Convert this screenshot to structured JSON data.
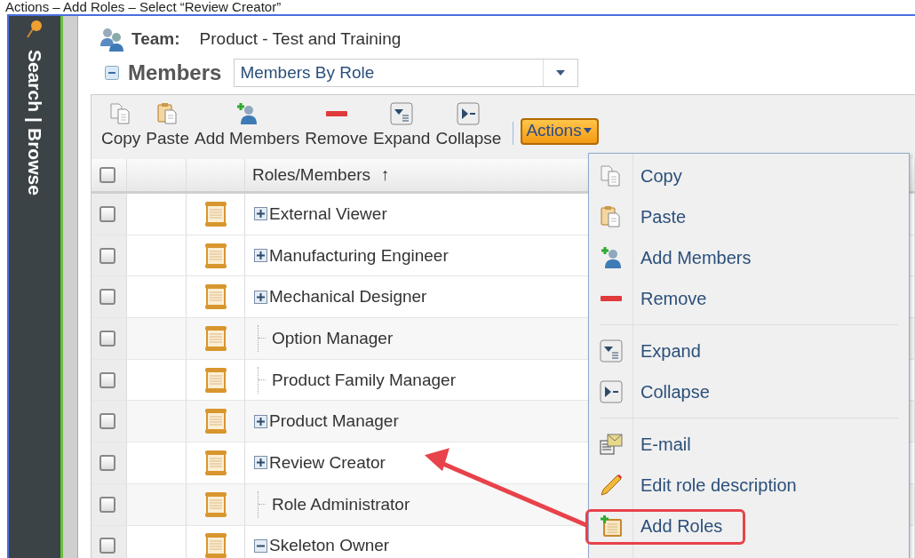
{
  "caption": "Actions – Add Roles – Select “Review Creator”",
  "sidebar": {
    "links": [
      "Search",
      "Browse"
    ],
    "separator": "|"
  },
  "team": {
    "label": "Team:",
    "value": "Product - Test and Training"
  },
  "members": {
    "title": "Members",
    "expanded": true,
    "view": "Members By Role"
  },
  "toolbar": [
    "Copy",
    "Paste",
    "Add Members",
    "Remove",
    "Expand",
    "Collapse"
  ],
  "actions_button": "Actions",
  "table": {
    "header_checked": false,
    "column": "Roles/Members",
    "sort": "↑",
    "rows": [
      {
        "name": "External Viewer",
        "kind": "group",
        "expanded": false,
        "checked": false
      },
      {
        "name": "Manufacturing Engineer",
        "kind": "group",
        "expanded": false,
        "checked": false
      },
      {
        "name": "Mechanical Designer",
        "kind": "group",
        "expanded": false,
        "checked": false
      },
      {
        "name": "Option Manager",
        "kind": "leaf",
        "checked": false
      },
      {
        "name": "Product Family Manager",
        "kind": "leaf",
        "checked": false
      },
      {
        "name": "Product Manager",
        "kind": "group",
        "expanded": false,
        "checked": false
      },
      {
        "name": "Review Creator",
        "kind": "group",
        "expanded": false,
        "checked": false
      },
      {
        "name": "Role Administrator",
        "kind": "leaf",
        "checked": false
      },
      {
        "name": "Skeleton Owner",
        "kind": "group",
        "expanded": true,
        "checked": false
      }
    ]
  },
  "menu": {
    "sections": [
      [
        {
          "label": "Copy",
          "highlighted": false
        },
        {
          "label": "Paste",
          "highlighted": false
        },
        {
          "label": "Add Members",
          "highlighted": false
        },
        {
          "label": "Remove",
          "highlighted": false
        }
      ],
      [
        {
          "label": "Expand",
          "highlighted": false
        },
        {
          "label": "Collapse",
          "highlighted": false
        }
      ],
      [
        {
          "label": "E-mail",
          "highlighted": false
        },
        {
          "label": "Edit role description",
          "highlighted": false
        },
        {
          "label": "Add Roles",
          "highlighted": true
        }
      ]
    ]
  }
}
